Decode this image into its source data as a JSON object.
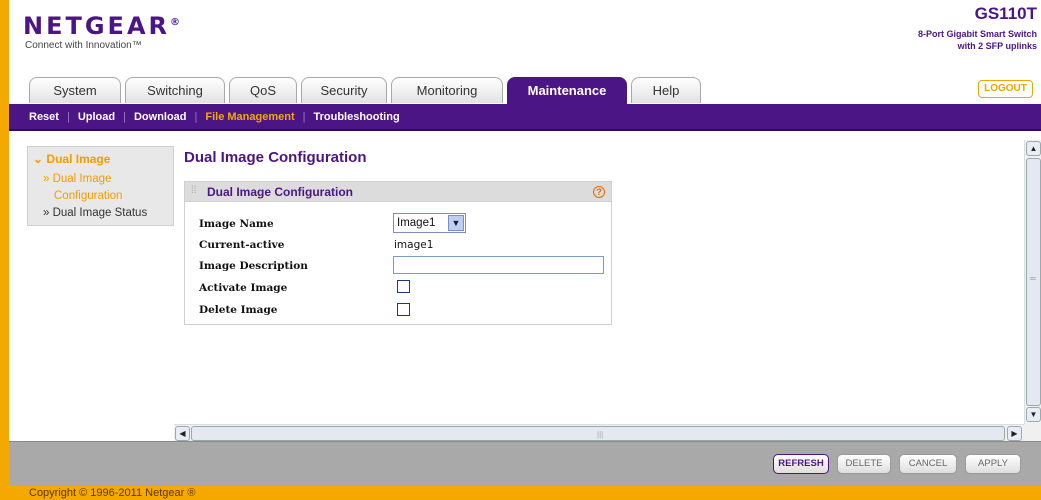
{
  "header": {
    "brand": "NETGEAR",
    "brand_mark": "®",
    "tagline": "Connect with Innovation™",
    "model": "GS110T",
    "model_desc_line1": "8-Port Gigabit Smart Switch",
    "model_desc_line2": "with 2 SFP uplinks",
    "logout_label": "LOGOUT"
  },
  "tabs": [
    {
      "label": "System"
    },
    {
      "label": "Switching"
    },
    {
      "label": "QoS"
    },
    {
      "label": "Security"
    },
    {
      "label": "Monitoring"
    },
    {
      "label": "Maintenance",
      "active": true
    },
    {
      "label": "Help"
    }
  ],
  "subnav": [
    {
      "label": "Reset"
    },
    {
      "label": "Upload"
    },
    {
      "label": "Download"
    },
    {
      "label": "File Management",
      "active": true
    },
    {
      "label": "Troubleshooting"
    }
  ],
  "leftnav": {
    "section": "Dual Image",
    "items": [
      {
        "label": "» Dual Image"
      },
      {
        "label": "Configuration"
      },
      {
        "label": "» Dual Image Status"
      }
    ]
  },
  "main": {
    "page_title": "Dual Image Configuration",
    "panel_title": "Dual Image Configuration",
    "help_glyph": "?",
    "rows": {
      "image_name_label": "Image Name",
      "image_name_value": "Image1",
      "current_active_label": "Current-active",
      "current_active_value": "image1",
      "image_description_label": "Image Description",
      "image_description_value": "",
      "activate_image_label": "Activate Image",
      "activate_image_checked": false,
      "delete_image_label": "Delete Image",
      "delete_image_checked": false
    }
  },
  "buttons": {
    "refresh": "REFRESH",
    "delete": "DELETE",
    "cancel": "CANCEL",
    "apply": "APPLY"
  },
  "footer": {
    "copyright": "Copyright © 1996-2011 Netgear ®"
  },
  "colors": {
    "brand_purple": "#4b1585",
    "accent_orange": "#f5a800"
  }
}
